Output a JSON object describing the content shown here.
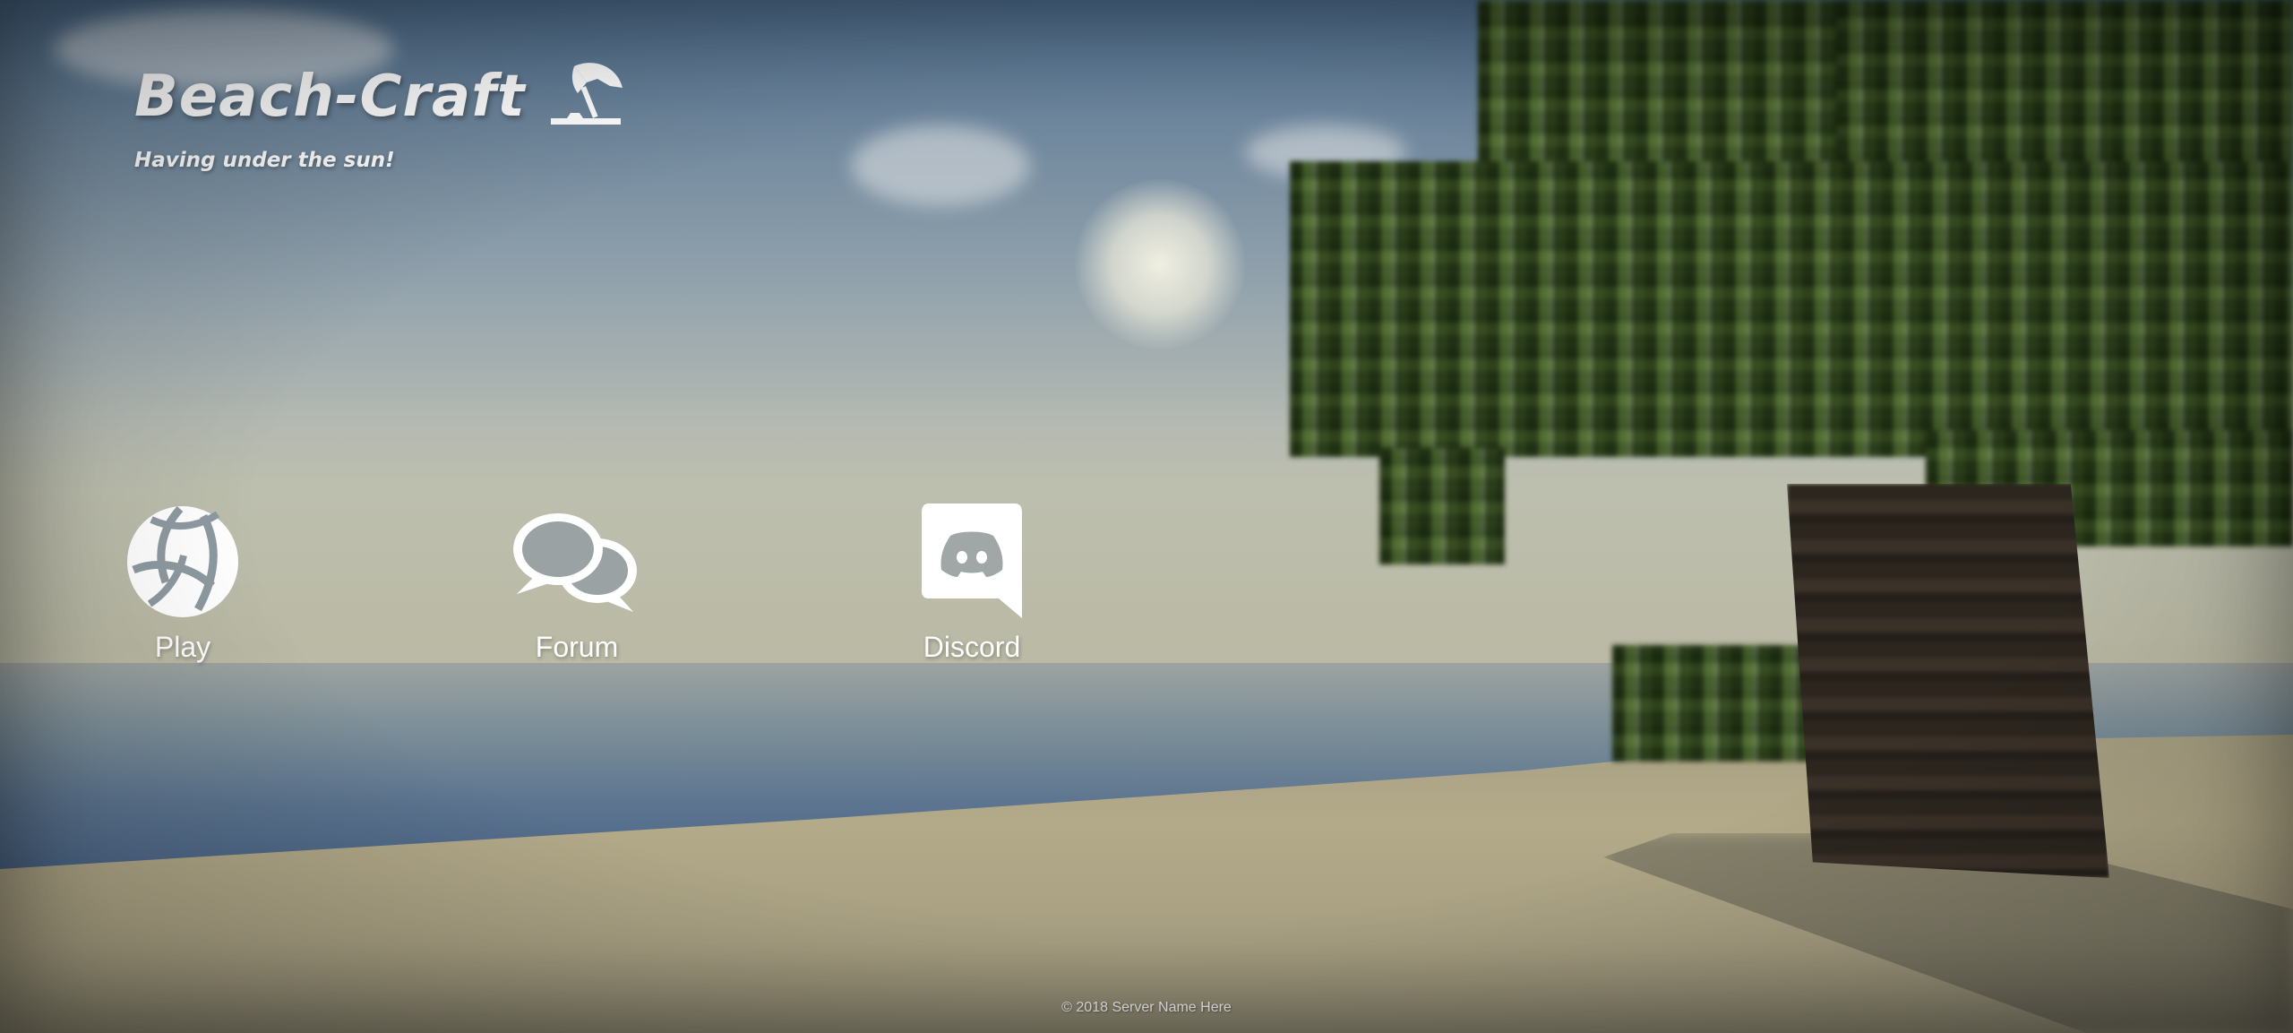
{
  "brand": {
    "name": "Beach-Craft",
    "tagline": "Having under the sun!",
    "icon": "beach-umbrella-icon"
  },
  "nav": {
    "items": [
      {
        "label": "Play",
        "icon": "volleyball-icon"
      },
      {
        "label": "Forum",
        "icon": "chat-bubbles-icon"
      },
      {
        "label": "Discord",
        "icon": "discord-logo-icon"
      }
    ]
  },
  "footer": {
    "copyright": "© 2018 Server Name Here"
  },
  "colors": {
    "text": "#ffffff",
    "sky": "#6e869c",
    "sand": "#b3aa89",
    "sea": "#5d7590"
  }
}
